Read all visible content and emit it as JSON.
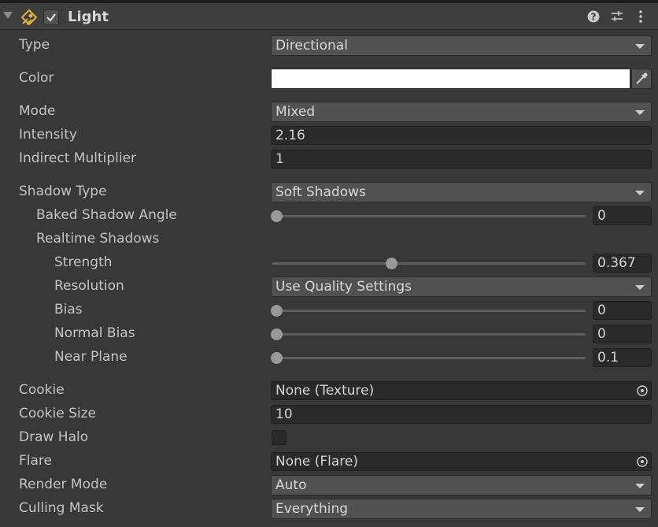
{
  "component": {
    "title": "Light",
    "enabled": true
  },
  "header_icons": [
    "fold-triangle-icon",
    "light-component-icon",
    "help-icon",
    "presets-icon",
    "context-menu-icon"
  ],
  "colors": {
    "background": "#383838",
    "field": "#2a2a2a",
    "dropdown": "#515151",
    "color_swatch": "#ffffff"
  },
  "fields": {
    "type": {
      "label": "Type",
      "value": "Directional"
    },
    "color": {
      "label": "Color",
      "value": "#ffffff"
    },
    "mode": {
      "label": "Mode",
      "value": "Mixed"
    },
    "intensity": {
      "label": "Intensity",
      "value": "2.16"
    },
    "indirect_multiplier": {
      "label": "Indirect Multiplier",
      "value": "1"
    },
    "shadow_type": {
      "label": "Shadow Type",
      "value": "Soft Shadows"
    },
    "baked_shadow_angle": {
      "label": "Baked Shadow Angle",
      "value": "0",
      "fraction": 0.0
    },
    "realtime_shadows": {
      "label": "Realtime Shadows"
    },
    "strength": {
      "label": "Strength",
      "value": "0.367",
      "fraction": 0.367
    },
    "resolution": {
      "label": "Resolution",
      "value": "Use Quality Settings"
    },
    "bias": {
      "label": "Bias",
      "value": "0",
      "fraction": 0.0
    },
    "normal_bias": {
      "label": "Normal Bias",
      "value": "0",
      "fraction": 0.0
    },
    "near_plane": {
      "label": "Near Plane",
      "value": "0.1",
      "fraction": 0.0
    },
    "cookie": {
      "label": "Cookie",
      "value": "None (Texture)"
    },
    "cookie_size": {
      "label": "Cookie Size",
      "value": "10"
    },
    "draw_halo": {
      "label": "Draw Halo",
      "checked": false
    },
    "flare": {
      "label": "Flare",
      "value": "None (Flare)"
    },
    "render_mode": {
      "label": "Render Mode",
      "value": "Auto"
    },
    "culling_mask": {
      "label": "Culling Mask",
      "value": "Everything"
    }
  }
}
